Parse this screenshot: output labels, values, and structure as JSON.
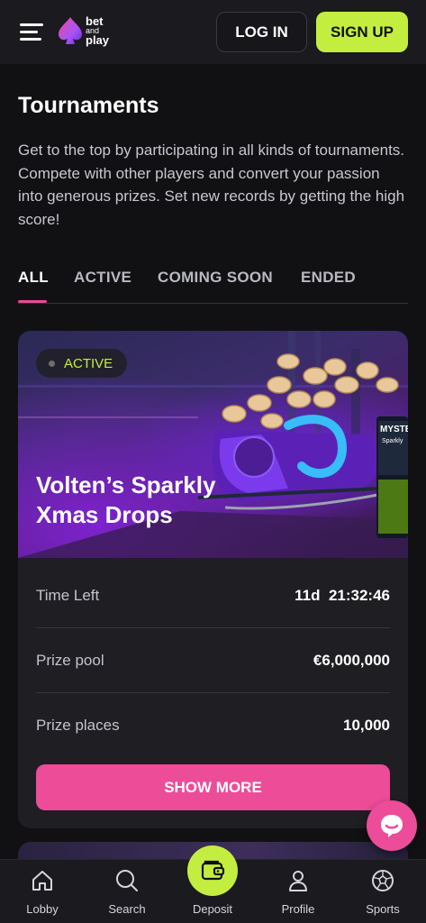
{
  "header": {
    "menu_icon": "hamburger-menu-icon",
    "logo": {
      "line1": "bet",
      "line2": "and",
      "line3": "play"
    },
    "login_label": "LOG IN",
    "signup_label": "SIGN UP",
    "colors": {
      "signup_bg": "#c4ee3f",
      "accent_pink": "#ec4c98"
    }
  },
  "page": {
    "title": "Tournaments",
    "intro": "Get to the top by participating in all kinds of tournaments. Compete with other players and convert your passion into generous prizes. Set new records by getting the high score!"
  },
  "tabs": [
    {
      "label": "ALL",
      "active": true
    },
    {
      "label": "ACTIVE",
      "active": false
    },
    {
      "label": "COMING SOON",
      "active": false
    },
    {
      "label": "ENDED",
      "active": false
    }
  ],
  "tournament": {
    "status": "ACTIVE",
    "title": "Volten’s Sparkly Xmas Drops",
    "hero_badge_text": "MYSTER",
    "hero_badge_sub": "Sparkly",
    "rows": [
      {
        "label": "Time Left",
        "value": "11d  21:32:46"
      },
      {
        "label": "Prize pool",
        "value": "€6,000,000"
      },
      {
        "label": "Prize places",
        "value": "10,000"
      }
    ],
    "show_more_label": "SHOW MORE"
  },
  "chat": {
    "icon": "chat-bubble-icon"
  },
  "bottom_nav": [
    {
      "label": "Lobby",
      "icon": "home-icon"
    },
    {
      "label": "Search",
      "icon": "search-icon"
    },
    {
      "label": "Deposit",
      "icon": "wallet-icon"
    },
    {
      "label": "Profile",
      "icon": "user-icon"
    },
    {
      "label": "Sports",
      "icon": "soccer-ball-icon"
    }
  ]
}
